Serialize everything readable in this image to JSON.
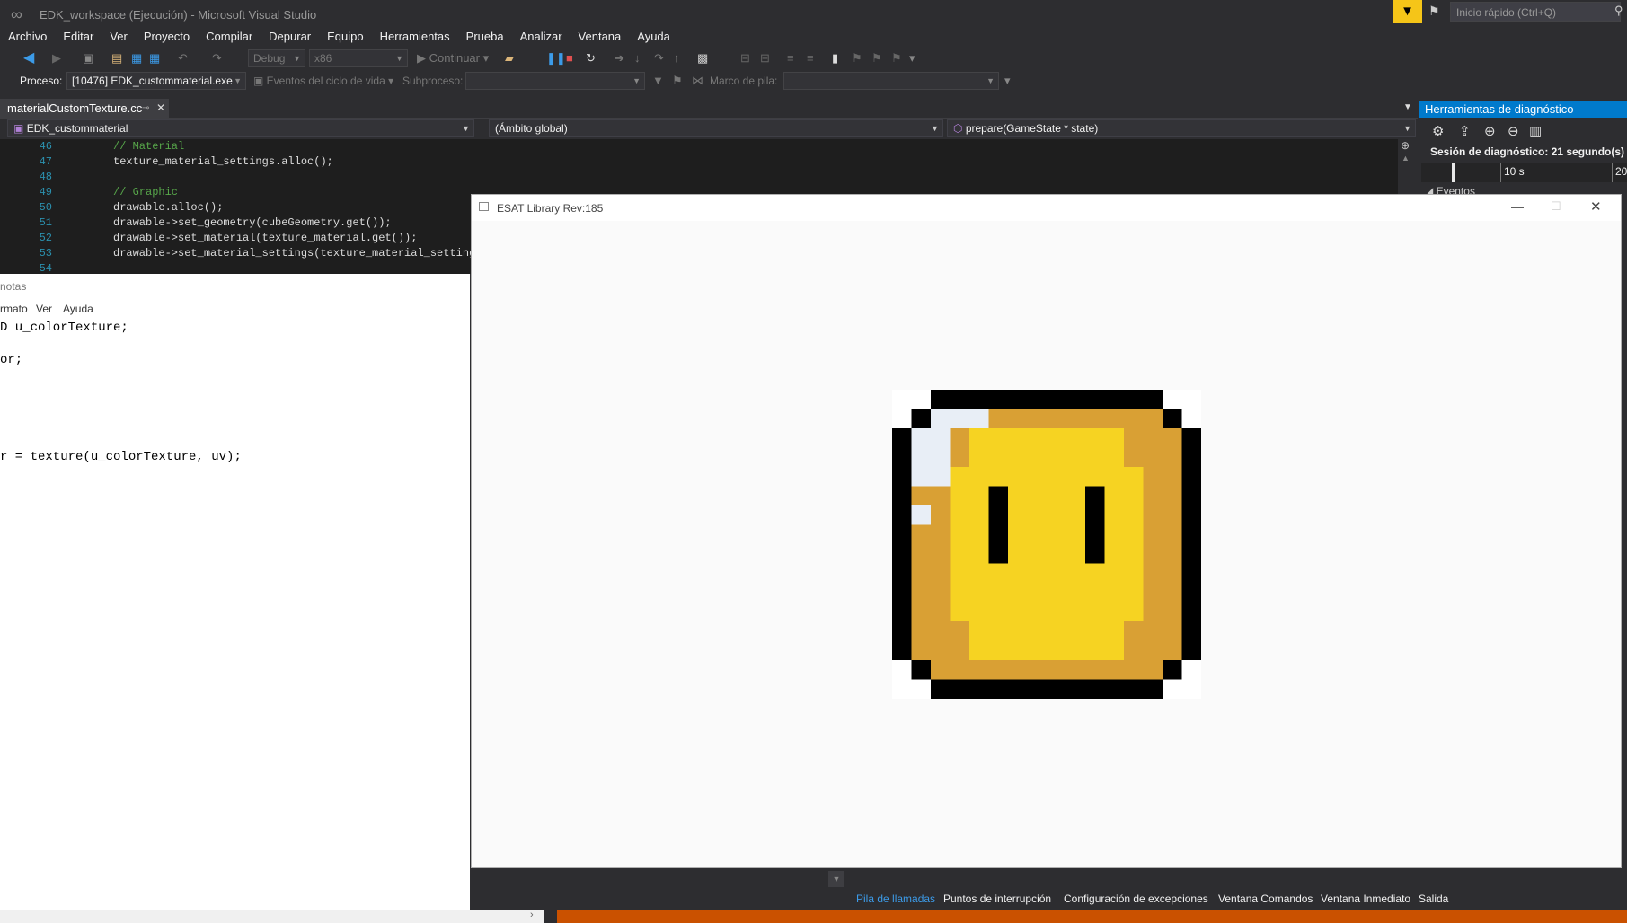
{
  "window": {
    "title": "EDK_workspace (Ejecución) - Microsoft Visual Studio"
  },
  "quick_launch": {
    "placeholder": "Inicio rápido (Ctrl+Q)"
  },
  "menu": [
    "Archivo",
    "Editar",
    "Ver",
    "Proyecto",
    "Compilar",
    "Depurar",
    "Equipo",
    "Herramientas",
    "Prueba",
    "Analizar",
    "Ventana",
    "Ayuda"
  ],
  "toolbar": {
    "config": "Debug",
    "platform": "x86",
    "continue_label": "Continuar",
    "process_label": "Proceso:",
    "process_value": "[10476] EDK_custommaterial.exe",
    "lifecycle_label": "Eventos del ciclo de vida",
    "thread_label": "Subproceso:",
    "stack_label": "Marco de pila:"
  },
  "editor": {
    "tab_name": "materialCustomTexture.cc",
    "project_combo": "EDK_custommaterial",
    "scope_combo": "(Ámbito global)",
    "member_combo": "prepare(GameState * state)",
    "lines": [
      {
        "num": "46",
        "text": "// Material",
        "comment": true
      },
      {
        "num": "47",
        "text": "texture_material_settings.alloc();",
        "comment": false
      },
      {
        "num": "48",
        "text": "",
        "comment": false
      },
      {
        "num": "49",
        "text": "// Graphic",
        "comment": true
      },
      {
        "num": "50",
        "text": "drawable.alloc();",
        "comment": false
      },
      {
        "num": "51",
        "text": "drawable->set_geometry(cubeGeometry.get());",
        "comment": false
      },
      {
        "num": "52",
        "text": "drawable->set_material(texture_material.get());",
        "comment": false
      },
      {
        "num": "53",
        "text": "drawable->set_material_settings(texture_material_settings",
        "comment": false
      },
      {
        "num": "54",
        "text": "",
        "comment": false
      }
    ]
  },
  "diagnostics": {
    "header": "Herramientas de diagnóstico",
    "session": "Sesión de diagnóstico: 21 segundo(s)",
    "tick_10": "10 s",
    "tick_20": "20",
    "events": "Eventos"
  },
  "notepad": {
    "title": "notas",
    "menu": [
      "rmato",
      "Ver",
      "Ayuda"
    ],
    "lines": [
      "D u_colorTexture;",
      "",
      "or;",
      "",
      "",
      "",
      "",
      "",
      "r = texture(u_colorTexture, uv);"
    ]
  },
  "esat": {
    "title": "ESAT Library Rev:185"
  },
  "bottom_tabs": [
    "Pila de llamadas",
    "Puntos de interrupción",
    "Configuración de excepciones",
    "Ventana Comandos",
    "Ventana Inmediato",
    "Salida"
  ],
  "colors": {
    "accent": "#007acc",
    "status": "#ca5100",
    "coin_gold": "#d9a034",
    "coin_yellow": "#f6d322",
    "highlight": "#e8eef6"
  }
}
